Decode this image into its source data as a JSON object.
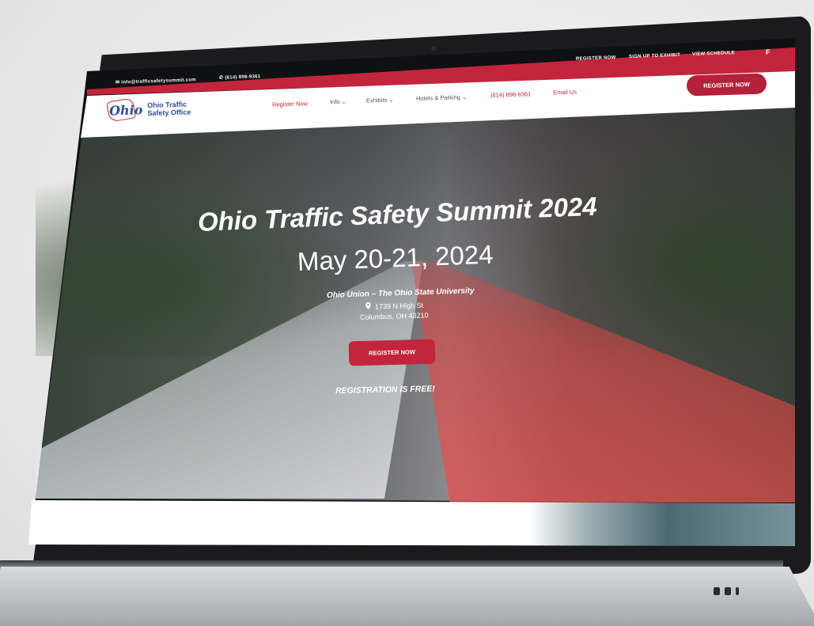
{
  "topbar": {
    "email": "info@trafficsafetysummit.com",
    "phone": "(614) 898-9361",
    "links": [
      "REGISTER NOW",
      "SIGN UP TO EXHIBIT",
      "VIEW SCHEDULE"
    ],
    "social": "f"
  },
  "logo": {
    "mark": "Ohio",
    "line1": "Ohio Traffic",
    "line2": "Safety Office"
  },
  "nav": {
    "items": [
      "Register Now",
      "Info",
      "Exhibits",
      "Hotels & Parking",
      "(614) 898-9361",
      "Email Us"
    ],
    "register_button": "REGISTER NOW"
  },
  "hero": {
    "title": "Ohio Traffic Safety Summit 2024",
    "date": "May 20-21, 2024",
    "venue": "Ohio Union – The Ohio State University",
    "address": "1739 N High St",
    "city": "Columbus, OH 43210",
    "button": "REGISTER NOW",
    "note": "REGISTRATION IS FREE!"
  },
  "colors": {
    "accent": "#c3253d",
    "brand_blue": "#2d4e9c"
  }
}
